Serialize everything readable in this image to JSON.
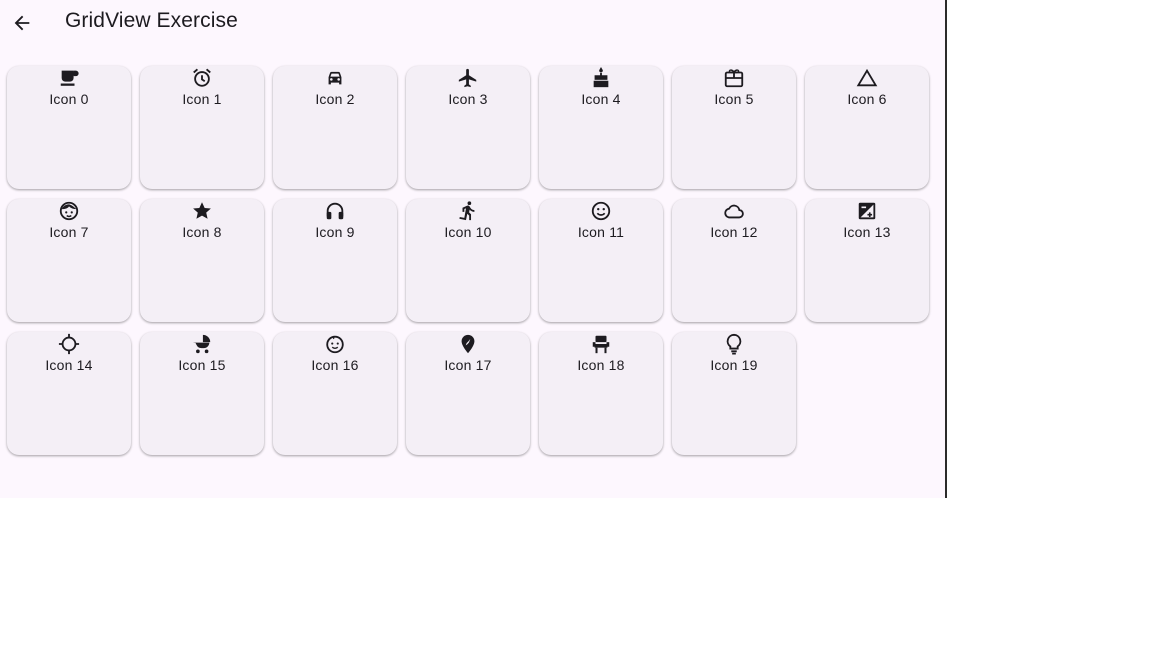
{
  "appbar": {
    "title": "GridView Exercise",
    "back_icon": "arrow-back-icon"
  },
  "colors": {
    "background": "#fdf7fe",
    "card": "#f4eff6",
    "text": "#1d1b20",
    "icon": "#1d1b20"
  },
  "grid": {
    "items": [
      {
        "label": "Icon 0",
        "icon": "coffee-icon"
      },
      {
        "label": "Icon 1",
        "icon": "alarm-icon"
      },
      {
        "label": "Icon 2",
        "icon": "car-icon"
      },
      {
        "label": "Icon 3",
        "icon": "airplane-icon"
      },
      {
        "label": "Icon 4",
        "icon": "cake-icon"
      },
      {
        "label": "Icon 5",
        "icon": "gift-card-icon"
      },
      {
        "label": "Icon 6",
        "icon": "triangle-icon"
      },
      {
        "label": "Icon 7",
        "icon": "child-face-icon"
      },
      {
        "label": "Icon 8",
        "icon": "star-icon"
      },
      {
        "label": "Icon 9",
        "icon": "headphones-icon"
      },
      {
        "label": "Icon 10",
        "icon": "walking-icon"
      },
      {
        "label": "Icon 11",
        "icon": "smiley-icon"
      },
      {
        "label": "Icon 12",
        "icon": "cloud-icon"
      },
      {
        "label": "Icon 13",
        "icon": "exposure-icon"
      },
      {
        "label": "Icon 14",
        "icon": "gps-icon"
      },
      {
        "label": "Icon 15",
        "icon": "stroller-icon"
      },
      {
        "label": "Icon 16",
        "icon": "baby-face-icon"
      },
      {
        "label": "Icon 17",
        "icon": "explore-pin-icon"
      },
      {
        "label": "Icon 18",
        "icon": "chair-icon"
      },
      {
        "label": "Icon 19",
        "icon": "lightbulb-icon"
      }
    ]
  }
}
